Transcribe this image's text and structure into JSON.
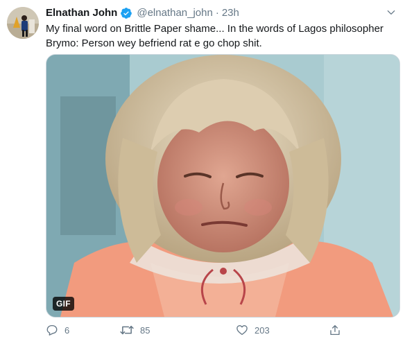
{
  "tweet": {
    "author_name": "Elnathan John",
    "handle": "@elnathan_john",
    "separator": "·",
    "time": "23h",
    "text": "My final word on Brittle Paper shame... In the words of Lagos philosopher Brymo: Person wey befriend rat e go chop shit.",
    "verified": true,
    "media": {
      "type": "gif",
      "badge": "GIF"
    }
  },
  "actions": {
    "reply_count": "6",
    "retweet_count": "85",
    "like_count": "203"
  },
  "colors": {
    "text_primary": "#14171a",
    "text_secondary": "#657786",
    "verified": "#1da1f2",
    "border": "#ccd6dd"
  }
}
